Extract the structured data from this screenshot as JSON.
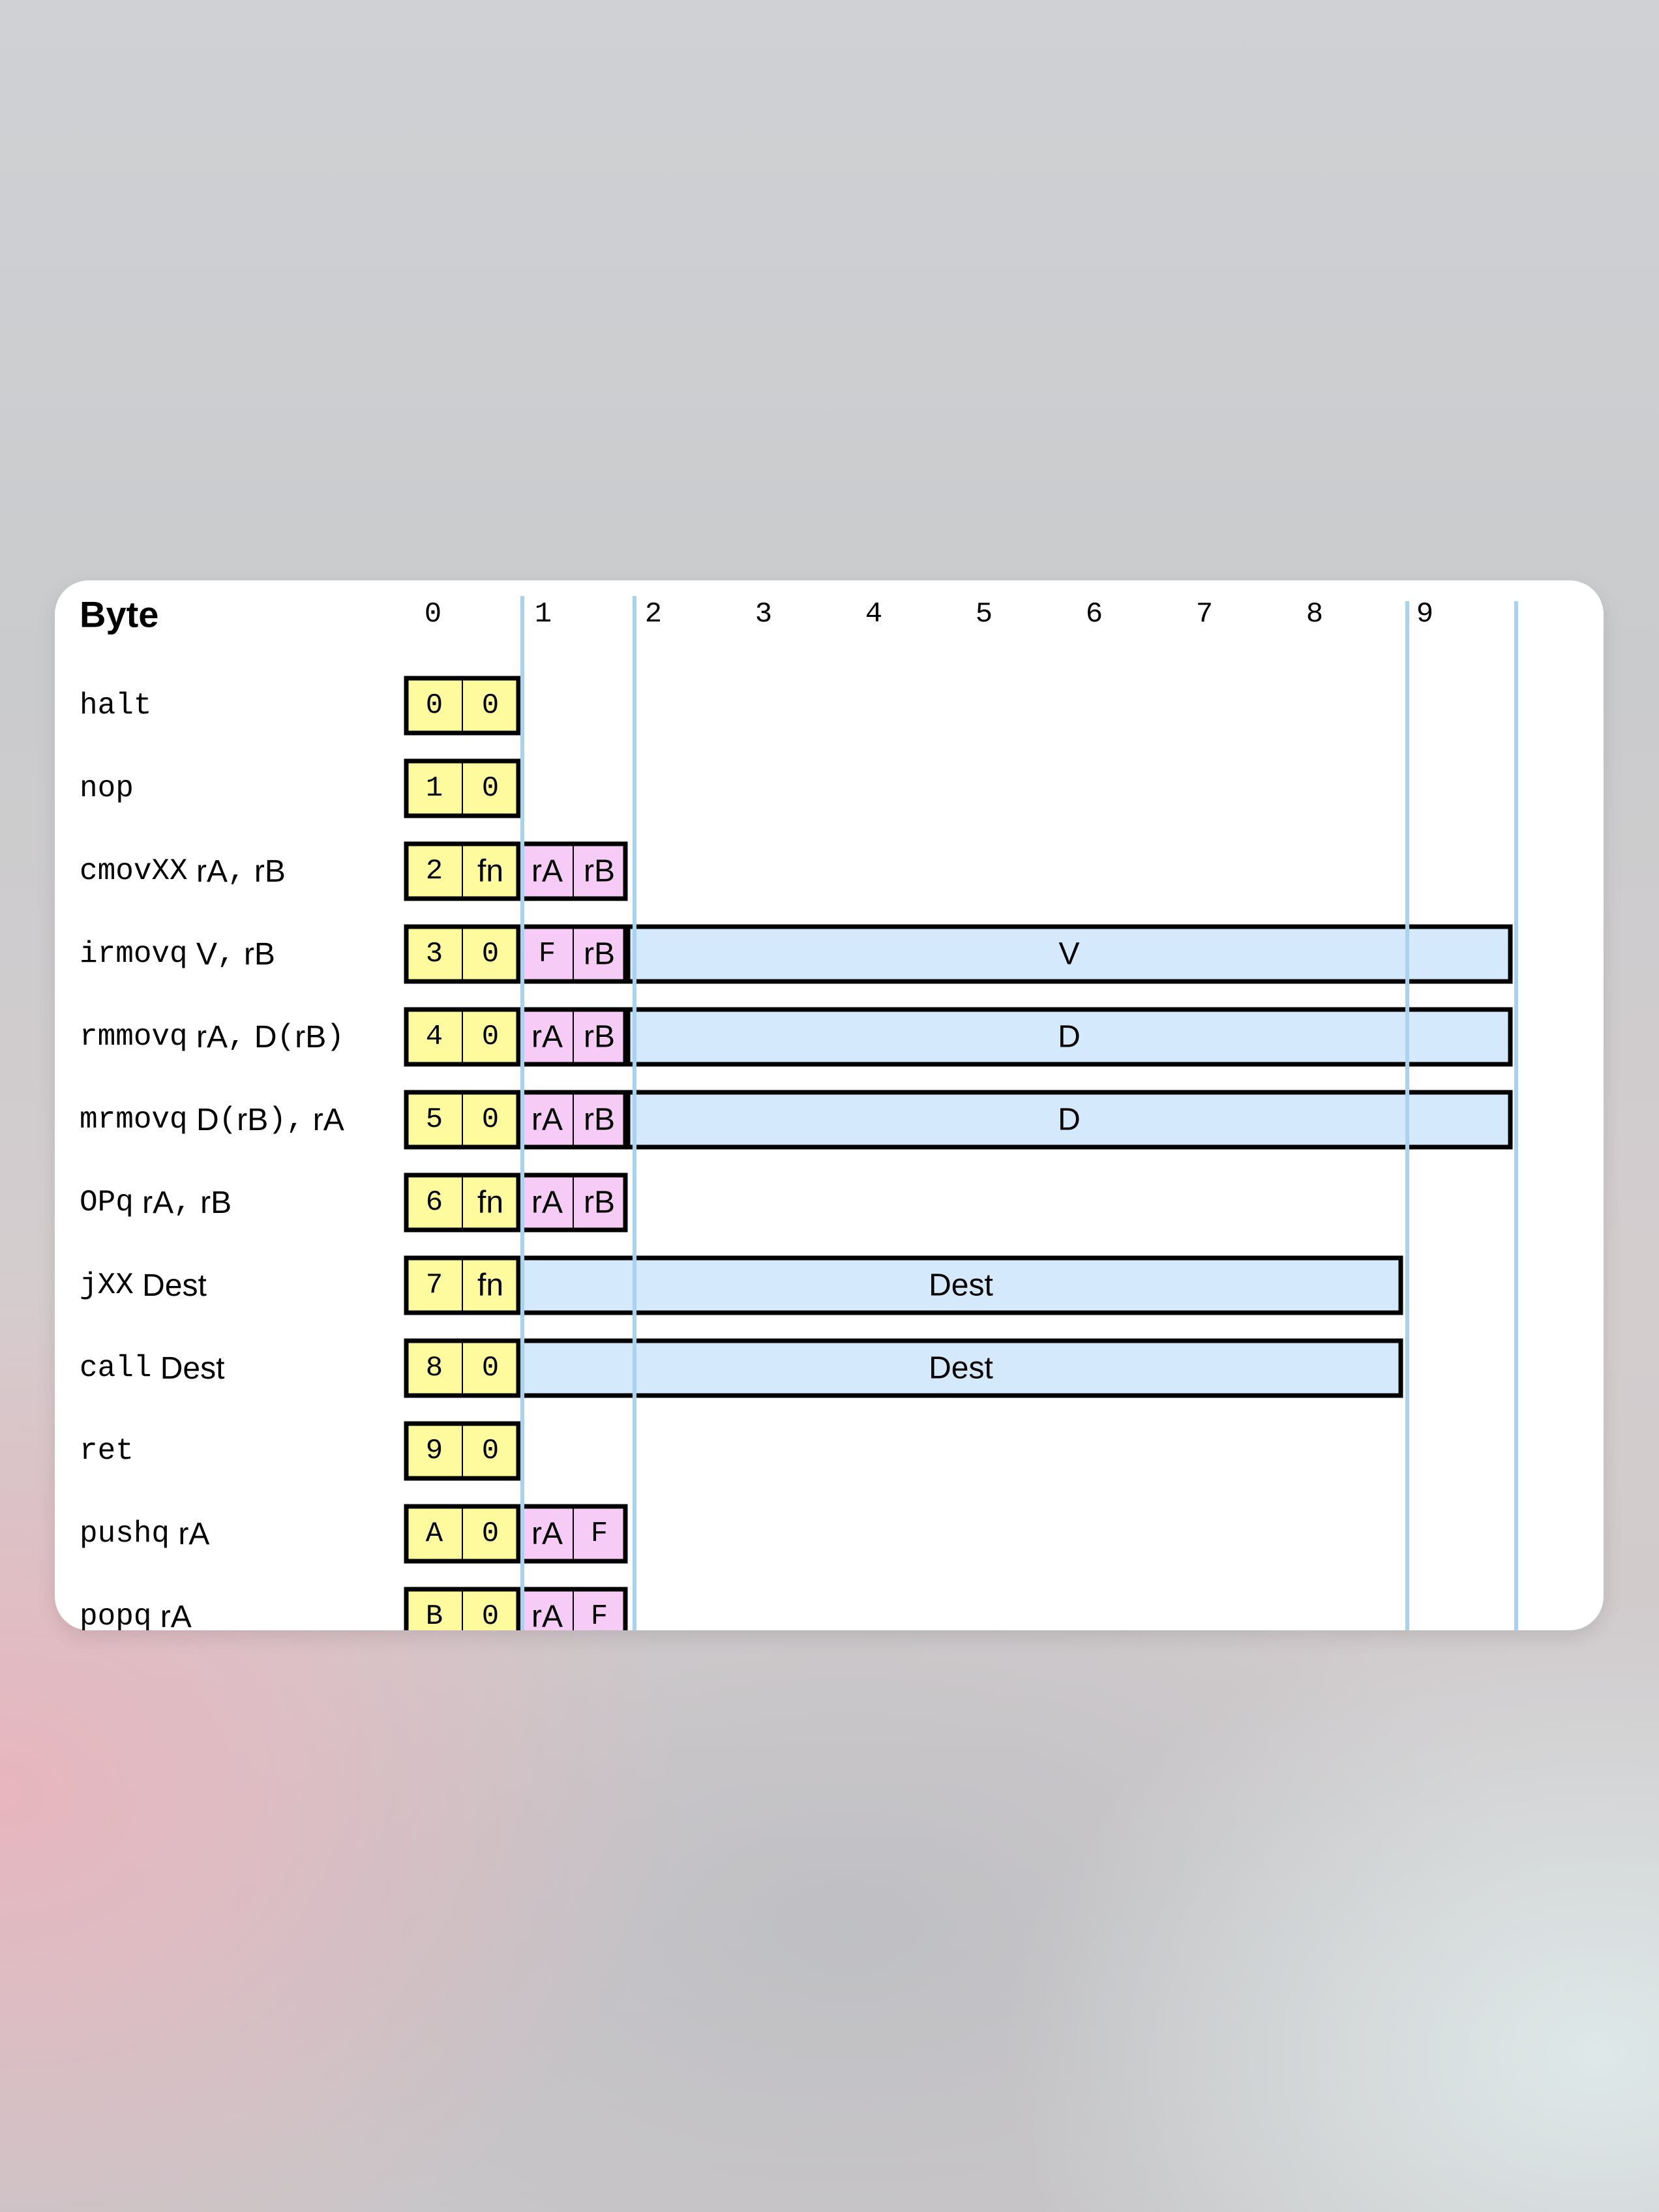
{
  "header": {
    "title": "Byte"
  },
  "byte_indices": [
    "0",
    "1",
    "2",
    "3",
    "4",
    "5",
    "6",
    "7",
    "8",
    "9"
  ],
  "colors": {
    "opcode_fill": "#fdfb9e",
    "register_fill": "#f6cbf5",
    "constant_fill": "#d4e9fb",
    "guide_line": "#a9d2ef",
    "border": "#000000"
  },
  "instructions": [
    {
      "mnemonic": "halt",
      "operand_parts": [],
      "opcode": [
        "0",
        "0"
      ]
    },
    {
      "mnemonic": "nop",
      "operand_parts": [],
      "opcode": [
        "1",
        "0"
      ]
    },
    {
      "mnemonic": "cmovXX",
      "operand_parts": [
        {
          "t": "rA",
          "mono": false
        },
        {
          "t": ",",
          "mono": true
        },
        {
          "t": " rB",
          "mono": false
        }
      ],
      "opcode": [
        "2",
        "fn"
      ],
      "regs": [
        "rA",
        "rB"
      ]
    },
    {
      "mnemonic": "irmovq",
      "operand_parts": [
        {
          "t": "V",
          "mono": false
        },
        {
          "t": ",",
          "mono": true
        },
        {
          "t": " rB",
          "mono": false
        }
      ],
      "opcode": [
        "3",
        "0"
      ],
      "regs": [
        "F",
        "rB"
      ],
      "constant": "V"
    },
    {
      "mnemonic": "rmmovq",
      "operand_parts": [
        {
          "t": "rA",
          "mono": false
        },
        {
          "t": ",",
          "mono": true
        },
        {
          "t": " D",
          "mono": false
        },
        {
          "t": "(",
          "mono": true
        },
        {
          "t": "rB",
          "mono": false
        },
        {
          "t": ")",
          "mono": true
        }
      ],
      "opcode": [
        "4",
        "0"
      ],
      "regs": [
        "rA",
        "rB"
      ],
      "constant": "D"
    },
    {
      "mnemonic": "mrmovq",
      "operand_parts": [
        {
          "t": "D",
          "mono": false
        },
        {
          "t": "(",
          "mono": true
        },
        {
          "t": "rB",
          "mono": false
        },
        {
          "t": "),",
          "mono": true
        },
        {
          "t": " rA",
          "mono": false
        }
      ],
      "opcode": [
        "5",
        "0"
      ],
      "regs": [
        "rA",
        "rB"
      ],
      "constant": "D"
    },
    {
      "mnemonic": "OPq",
      "operand_parts": [
        {
          "t": "rA",
          "mono": false
        },
        {
          "t": ",",
          "mono": true
        },
        {
          "t": " rB",
          "mono": false
        }
      ],
      "opcode": [
        "6",
        "fn"
      ],
      "regs": [
        "rA",
        "rB"
      ]
    },
    {
      "mnemonic": "jXX",
      "operand_parts": [
        {
          "t": "Dest",
          "mono": false
        }
      ],
      "opcode": [
        "7",
        "fn"
      ],
      "dest": "Dest"
    },
    {
      "mnemonic": "call",
      "operand_parts": [
        {
          "t": "Dest",
          "mono": false
        }
      ],
      "opcode": [
        "8",
        "0"
      ],
      "dest": "Dest"
    },
    {
      "mnemonic": "ret",
      "operand_parts": [],
      "opcode": [
        "9",
        "0"
      ]
    },
    {
      "mnemonic": "pushq",
      "operand_parts": [
        {
          "t": "rA",
          "mono": false
        }
      ],
      "opcode": [
        "A",
        "0"
      ],
      "regs": [
        "rA",
        "F"
      ]
    },
    {
      "mnemonic": "popq",
      "operand_parts": [
        {
          "t": "rA",
          "mono": false
        }
      ],
      "opcode": [
        "B",
        "0"
      ],
      "regs": [
        "rA",
        "F"
      ]
    }
  ]
}
